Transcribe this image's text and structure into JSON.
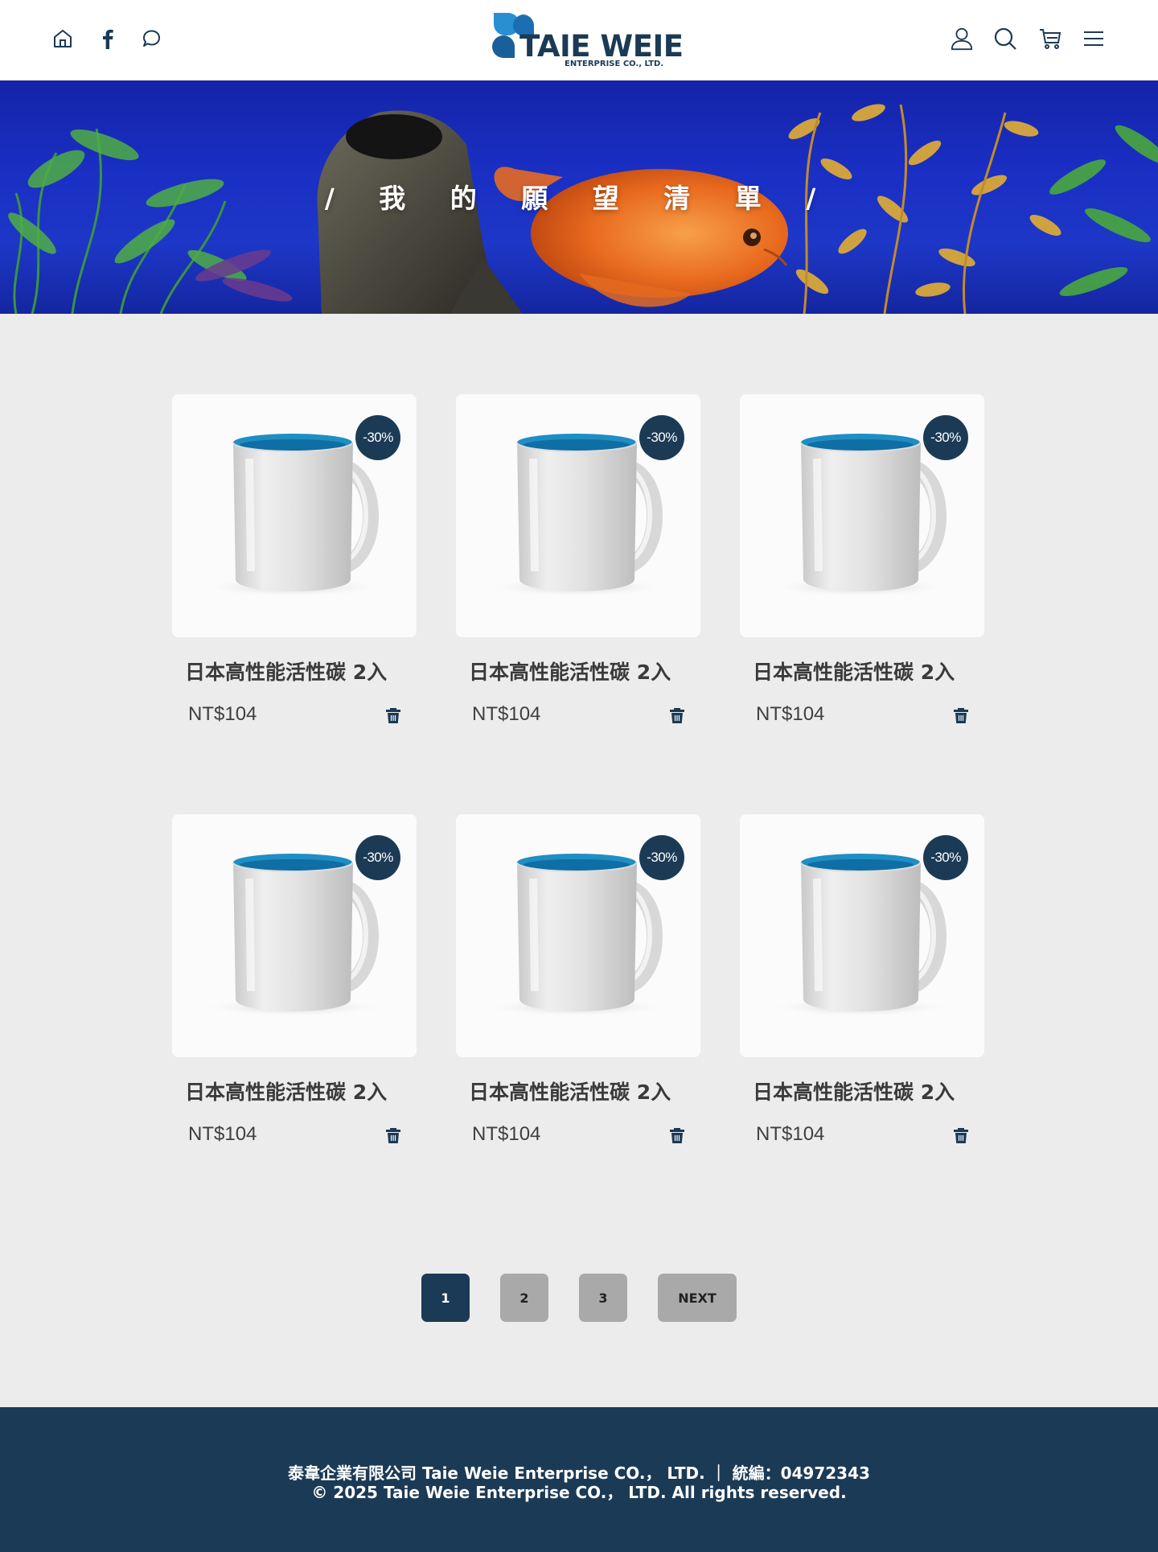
{
  "header": {
    "brand": "TAIE WEIE",
    "brand_sub": "ENTERPRISE CO., LTD.",
    "left_icons": [
      "home-icon",
      "facebook-icon",
      "chat-icon"
    ],
    "right_icons": [
      "user-icon",
      "search-icon",
      "cart-icon",
      "menu-icon"
    ]
  },
  "banner": {
    "title": "/ 我 的 願 望 清 單 /"
  },
  "products": [
    {
      "name": "日本高性能活性碳 2入",
      "price": "NT$104",
      "badge": "-30%"
    },
    {
      "name": "日本高性能活性碳 2入",
      "price": "NT$104",
      "badge": "-30%"
    },
    {
      "name": "日本高性能活性碳 2入",
      "price": "NT$104",
      "badge": "-30%"
    },
    {
      "name": "日本高性能活性碳 2入",
      "price": "NT$104",
      "badge": "-30%"
    },
    {
      "name": "日本高性能活性碳 2入",
      "price": "NT$104",
      "badge": "-30%"
    },
    {
      "name": "日本高性能活性碳 2入",
      "price": "NT$104",
      "badge": "-30%"
    }
  ],
  "pagination": {
    "pages": [
      "1",
      "2",
      "3"
    ],
    "active": "1",
    "next_label": "NEXT"
  },
  "footer": {
    "line1": "泰韋企業有限公司 Taie Weie Enterprise CO.， LTD. ｜ 統編：04972343",
    "line2": "© 2025 Taie Weie Enterprise CO.， LTD. All rights reserved."
  },
  "colors": {
    "primary": "#1b3a55",
    "page_bg": "#ececec",
    "pager_inactive": "#a9a9a9",
    "mug_inner": "#1e8ec4"
  }
}
